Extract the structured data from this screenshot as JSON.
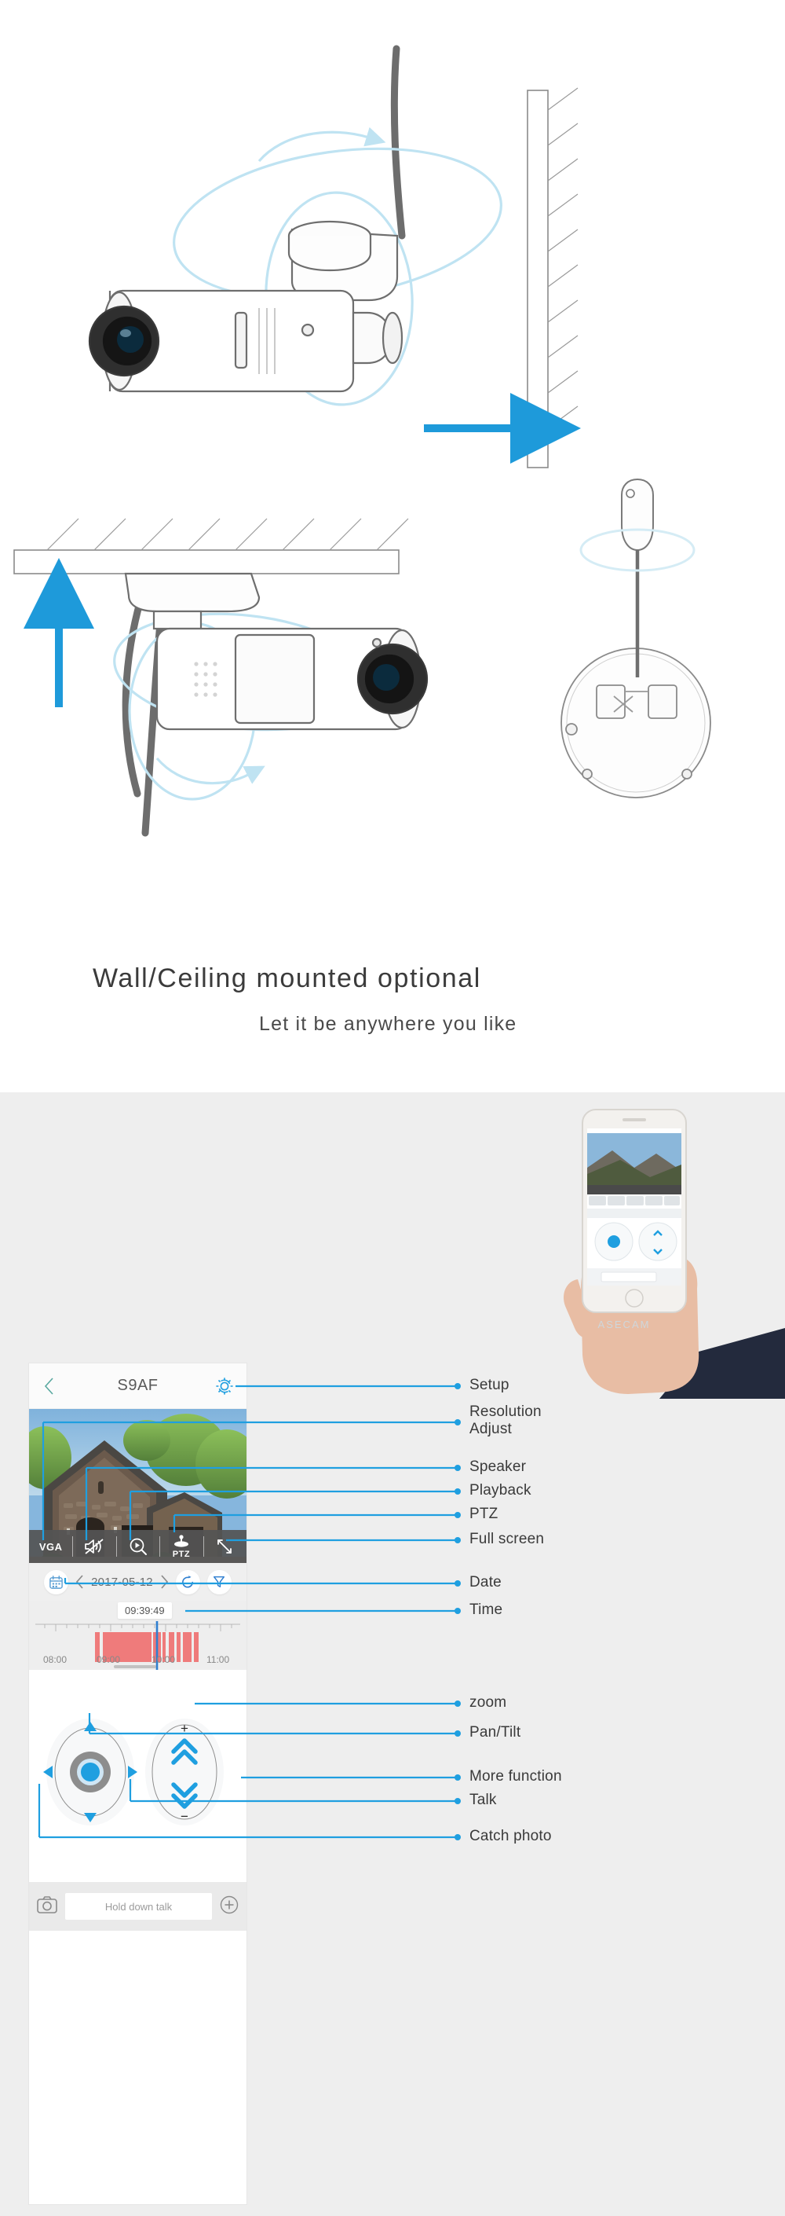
{
  "headings": {
    "main": "Wall/Ceiling mounted optional",
    "sub": "Let it be anywhere you like"
  },
  "illustration": {
    "alt_top": "wall-mounted-camera-rotation-diagram",
    "alt_bottom_left": "ceiling-mounted-camera-rotation-diagram",
    "alt_bottom_right": "mounting-base-screw-diagram"
  },
  "app": {
    "header": {
      "back_icon": "chevron-left-icon",
      "title": "S9AF",
      "settings_icon": "gear-icon"
    },
    "toolbar": [
      {
        "label": "VGA",
        "icon": "resolution-text",
        "name": "resolution"
      },
      {
        "label": "",
        "icon": "speaker-muted-icon",
        "name": "speaker"
      },
      {
        "label": "",
        "icon": "playback-search-icon",
        "name": "playback"
      },
      {
        "label": "PTZ",
        "icon": "joystick-icon",
        "name": "ptz"
      },
      {
        "label": "",
        "icon": "fullscreen-arrows-icon",
        "name": "fullscreen"
      }
    ],
    "date_bar": {
      "calendar_icon": "calendar-icon",
      "prev_icon": "chevron-left-icon",
      "date": "2017-05-12",
      "next_icon": "chevron-right-icon",
      "refresh_icon": "refresh-icon",
      "filter_icon": "filter-funnel-icon"
    },
    "timeline": {
      "current_time": "09:39:49",
      "hours": [
        "08:00",
        "09:00",
        "10:00",
        "11:00"
      ],
      "playhead_label": "timeline-playhead"
    },
    "ptz": {
      "pan_tilt": {
        "up_icon": "triangle-up-icon",
        "down_icon": "triangle-down-icon",
        "left_icon": "triangle-left-icon",
        "right_icon": "triangle-right-icon",
        "center_icon": "joystick-knob"
      },
      "zoom": {
        "plus_label": "+",
        "minus_label": "−",
        "zoom_in_icon": "double-chevron-up-icon",
        "zoom_out_icon": "double-chevron-down-icon"
      }
    },
    "bottom_bar": {
      "camera_icon": "camera-icon",
      "talk_placeholder": "Hold down talk",
      "more_icon": "plus-circle-icon"
    }
  },
  "annotations": [
    {
      "id": "setup",
      "text": "Setup"
    },
    {
      "id": "resolution",
      "text": "Resolution\nAdjust"
    },
    {
      "id": "speaker",
      "text": "Speaker"
    },
    {
      "id": "playback",
      "text": "Playback"
    },
    {
      "id": "ptz",
      "text": "PTZ"
    },
    {
      "id": "fullscreen",
      "text": "Full screen"
    },
    {
      "id": "date",
      "text": "Date"
    },
    {
      "id": "time",
      "text": "Time"
    },
    {
      "id": "zoom",
      "text": "zoom"
    },
    {
      "id": "pantilt",
      "text": "Pan/Tilt"
    },
    {
      "id": "morefunction",
      "text": "More function"
    },
    {
      "id": "talk",
      "text": "Talk"
    },
    {
      "id": "catchphoto",
      "text": "Catch photo"
    }
  ],
  "colors": {
    "accent_blue": "#1f9fe0",
    "arrow_blue": "#1e9ada",
    "toolbar_bg": "#545454",
    "timeline_red": "#ef7b7b",
    "page_bg": "#eeeeee"
  }
}
